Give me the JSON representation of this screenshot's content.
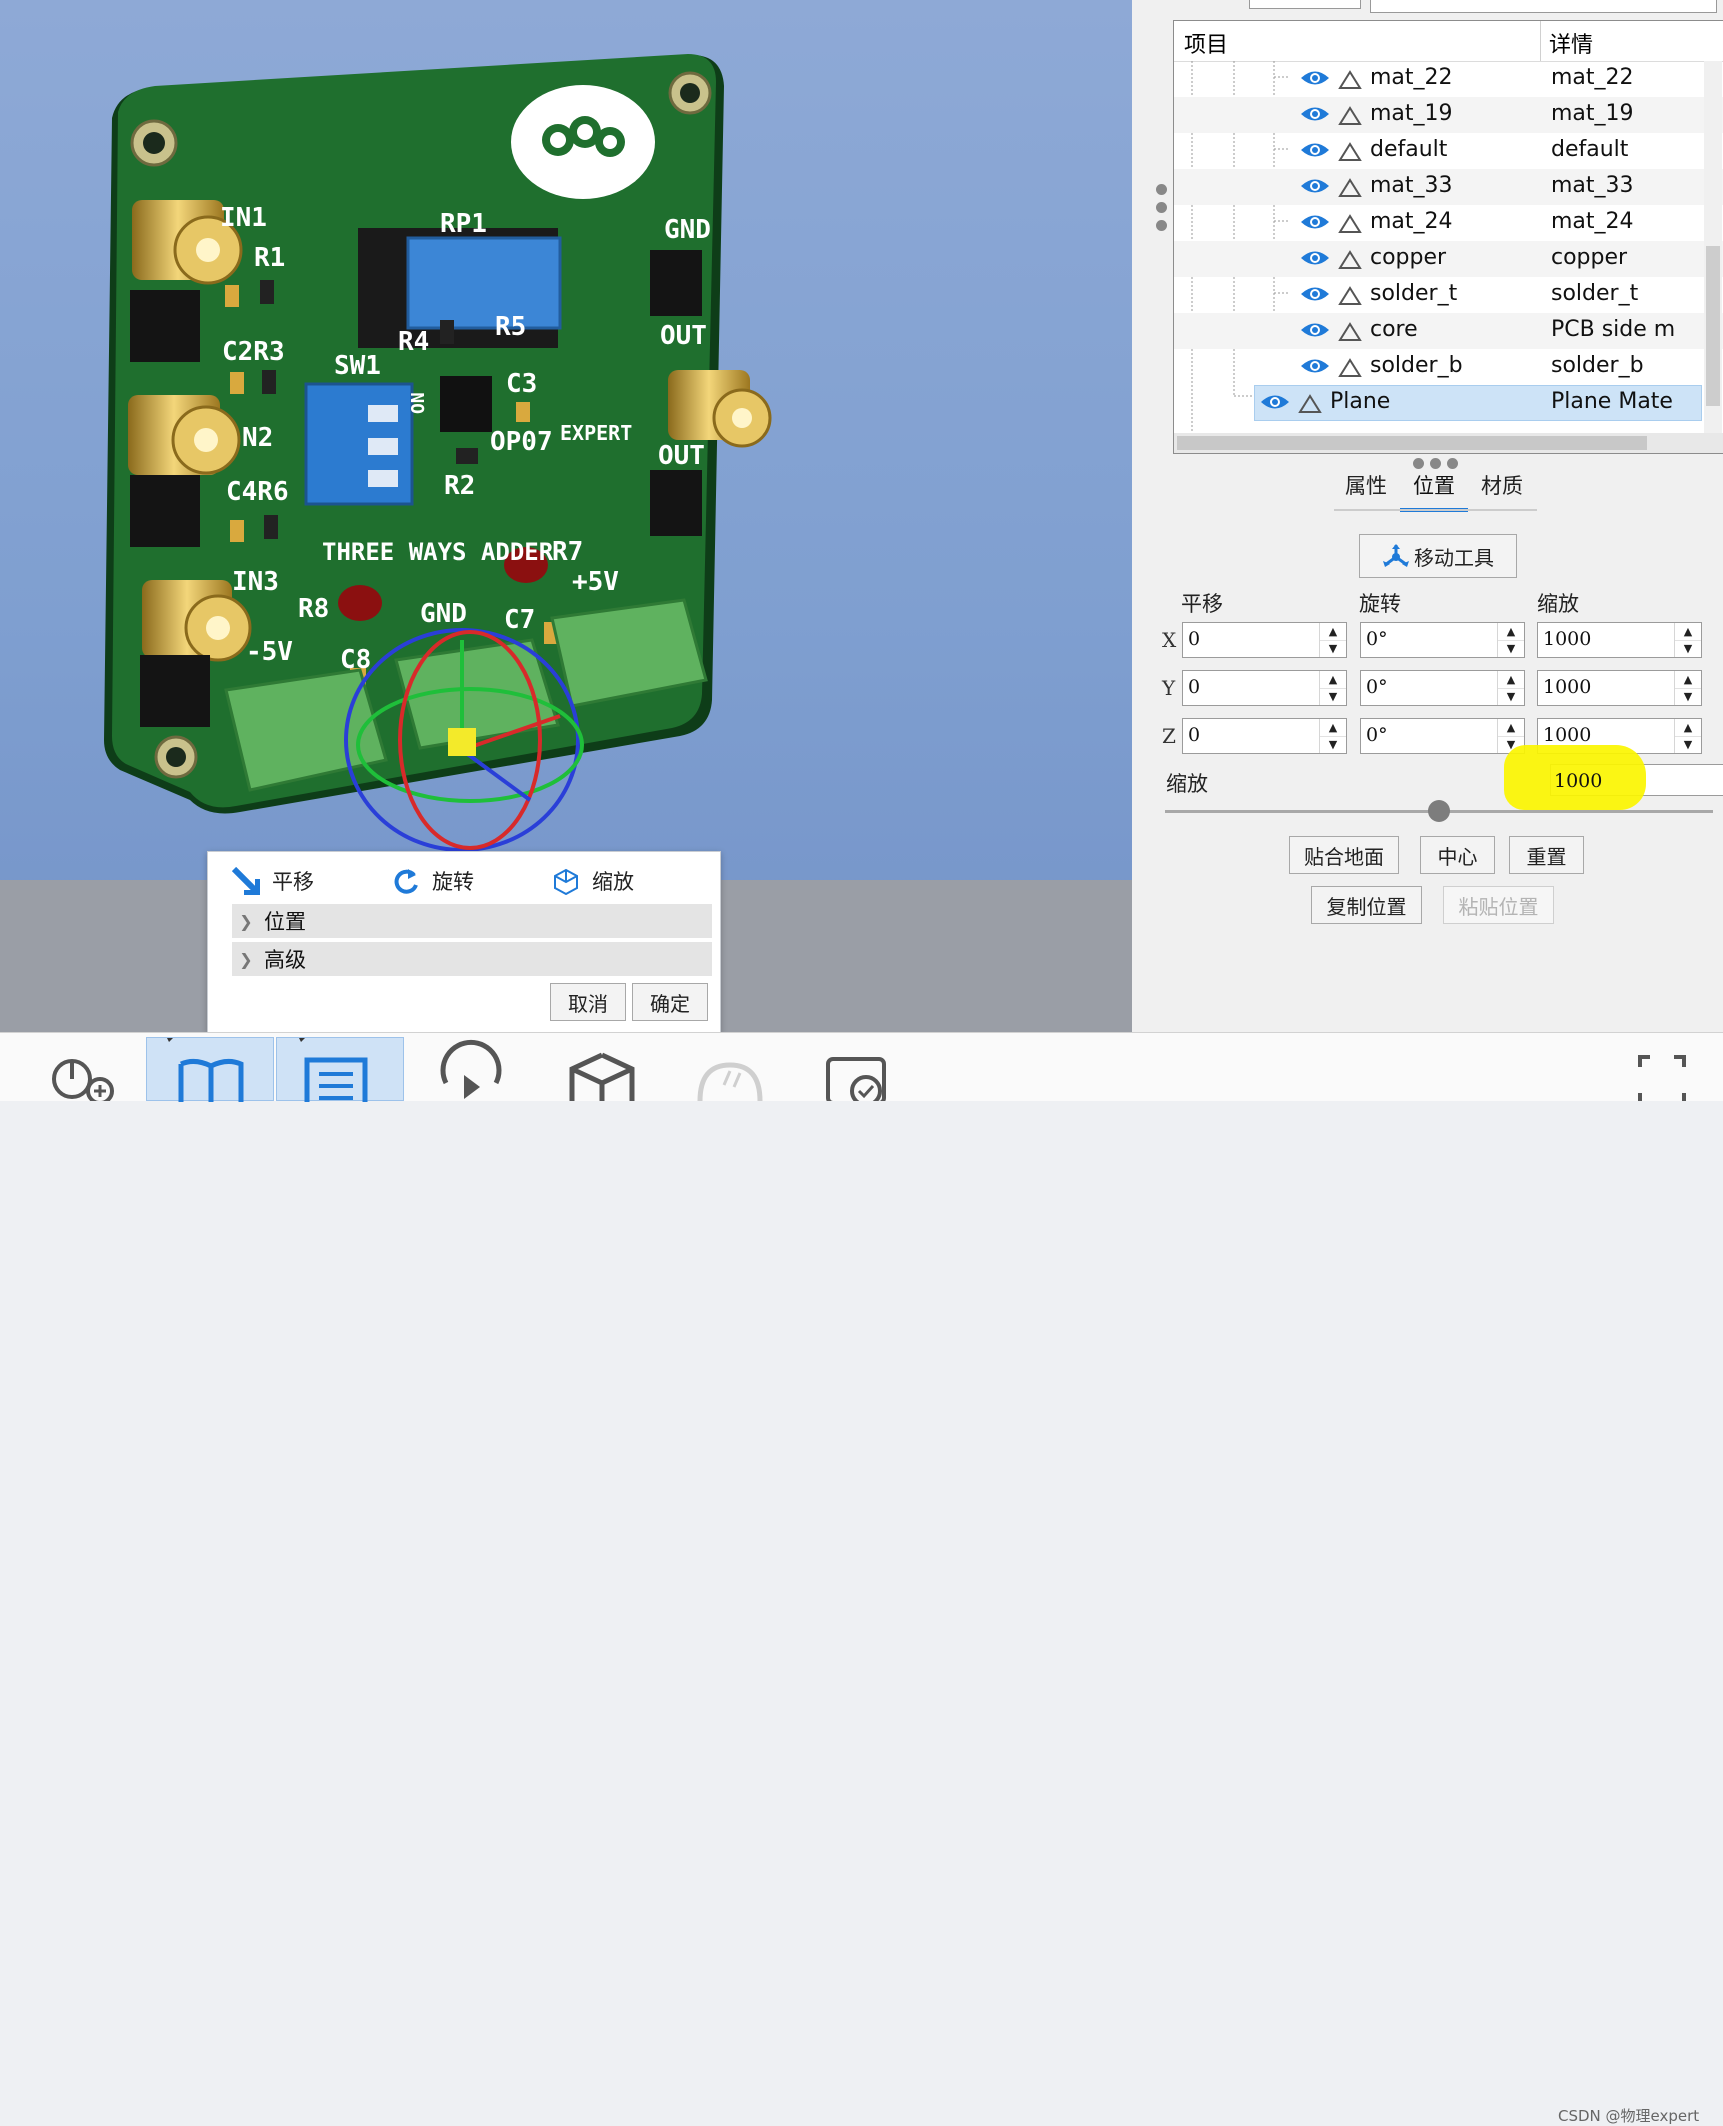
{
  "viewport": {
    "board_labels": {
      "in1": "IN1",
      "r1": "R1",
      "c2r3": "C2R3",
      "rp1": "RP1",
      "r4": "R4",
      "r5": "R5",
      "sw1": "SW1",
      "on": "ON",
      "c3": "C3",
      "op07": "OP07",
      "expert": "EXPERT",
      "gnd_top": "GND",
      "out1": "OUT",
      "out2": "OUT",
      "in2": "N2",
      "c4r6": "C4R6",
      "r2": "R2",
      "three_ways": "THREE WAYS ADDER",
      "r7": "R7",
      "in3": "IN3",
      "r8": "R8",
      "gnd_bottom": "GND",
      "c7": "C7",
      "plus5v": "+5V",
      "minus5v": "-5V",
      "c8": "C8"
    }
  },
  "transform_panel": {
    "modes": [
      {
        "label": "平移",
        "icon": "move-arrow-icon"
      },
      {
        "label": "旋转",
        "icon": "rotate-icon"
      },
      {
        "label": "缩放",
        "icon": "scale-cube-icon"
      }
    ],
    "sections": [
      {
        "label": "位置",
        "icon": "chevron-right-icon"
      },
      {
        "label": "高级",
        "icon": "chevron-right-icon"
      }
    ],
    "cancel_label": "取消",
    "ok_label": "确定"
  },
  "tree": {
    "col_item": "项目",
    "col_detail": "详情",
    "rows": [
      {
        "name": "mat_22",
        "detail": "mat_22"
      },
      {
        "name": "mat_19",
        "detail": "mat_19"
      },
      {
        "name": "default",
        "detail": "default"
      },
      {
        "name": "mat_33",
        "detail": "mat_33"
      },
      {
        "name": "mat_24",
        "detail": "mat_24"
      },
      {
        "name": "copper",
        "detail": "copper"
      },
      {
        "name": "solder_t",
        "detail": "solder_t"
      },
      {
        "name": "core",
        "detail": "PCB side m"
      },
      {
        "name": "solder_b",
        "detail": "solder_b"
      },
      {
        "name": "Plane",
        "detail": "Plane Mate",
        "selected": true
      }
    ]
  },
  "props": {
    "tabs": [
      "属性",
      "位置",
      "材质"
    ],
    "active_tab": "位置",
    "move_tool_label": "移动工具",
    "col_translate": "平移",
    "col_rotate": "旋转",
    "col_scale": "缩放",
    "axes": [
      "X",
      "Y",
      "Z"
    ],
    "translate": [
      "0",
      "0",
      "0"
    ],
    "rotate": [
      "0°",
      "0°",
      "0°"
    ],
    "scale": [
      "1000",
      "1000",
      "1000"
    ],
    "uniform_scale_label": "缩放",
    "uniform_scale_value": "1000",
    "highlight_color": "#fbf500",
    "slider_value": 0.5,
    "btn_fit_ground": "贴合地面",
    "btn_center": "中心",
    "btn_reset": "重置",
    "btn_copy_pos": "复制位置",
    "btn_paste_pos": "粘贴位置"
  },
  "toolbar": {
    "icons": [
      "add-camera-icon",
      "book-icon",
      "list-icon",
      "replay-icon",
      "box-icon",
      "light-icon",
      "snapshot-icon",
      "fullscreen-icon"
    ],
    "active": [
      "book-icon",
      "list-icon"
    ]
  },
  "watermark": "CSDN @物理expert",
  "colors": {
    "accent": "#1f7ad8",
    "pcb": "#1d6b2c",
    "selection": "#cde3f7"
  }
}
